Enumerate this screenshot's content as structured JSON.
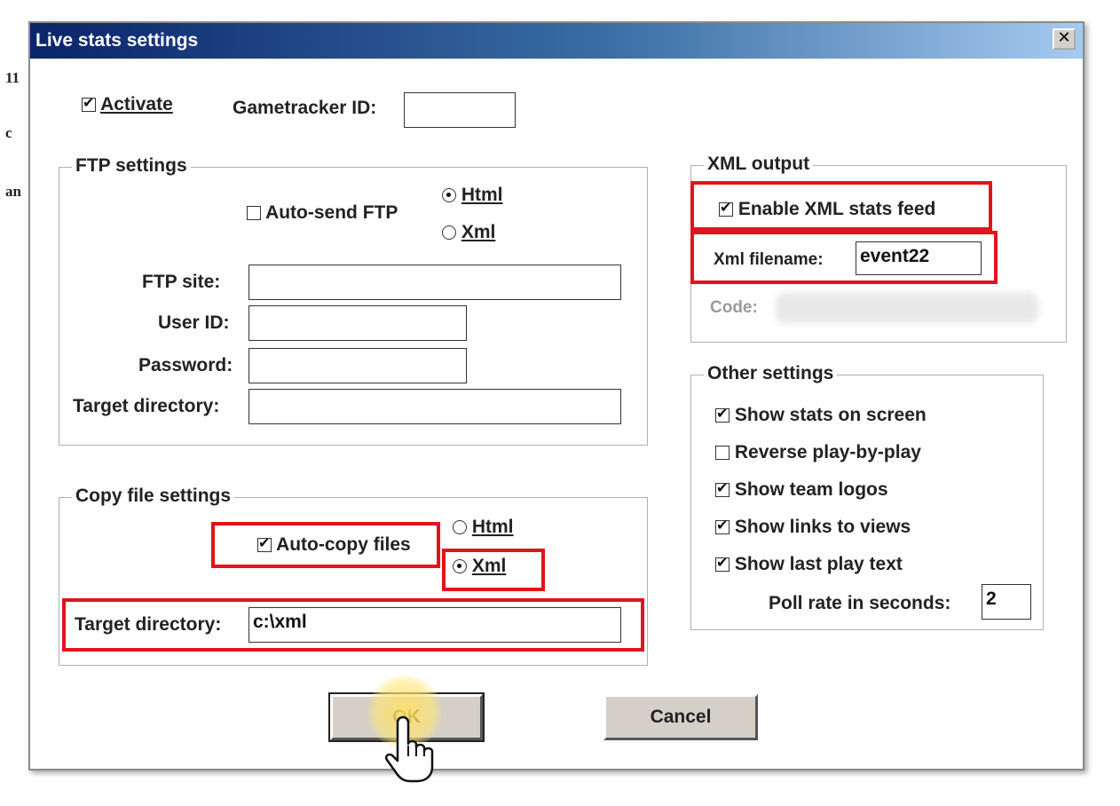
{
  "background": {
    "fragments": [
      "11",
      "c",
      "an"
    ]
  },
  "dialog": {
    "title": "Live stats settings",
    "close_glyph": "✕"
  },
  "activate": {
    "label": "Activate",
    "checked": true
  },
  "gametracker": {
    "label": "Gametracker ID:",
    "value": ""
  },
  "ftp": {
    "group_title": "FTP settings",
    "auto_send_label": "Auto-send FTP",
    "auto_send_checked": false,
    "format_html_label": "Html",
    "format_xml_label": "Xml",
    "format_selected": "Html",
    "site_label": "FTP site:",
    "site_value": "",
    "user_label": "User ID:",
    "user_value": "",
    "password_label": "Password:",
    "password_value": "",
    "target_label": "Target directory:",
    "target_value": ""
  },
  "copy": {
    "group_title": "Copy file settings",
    "auto_copy_label": "Auto-copy files",
    "auto_copy_checked": true,
    "format_html_label": "Html",
    "format_xml_label": "Xml",
    "format_selected": "Xml",
    "target_label": "Target directory:",
    "target_value": "c:\\xml"
  },
  "xml_output": {
    "group_title": "XML output",
    "enable_label": "Enable XML stats feed",
    "enable_checked": true,
    "filename_label": "Xml filename:",
    "filename_value": "event22",
    "code_label": "Code:"
  },
  "other": {
    "group_title": "Other settings",
    "items": [
      {
        "label": "Show stats on screen",
        "checked": true
      },
      {
        "label": "Reverse play-by-play",
        "checked": false
      },
      {
        "label": "Show team logos",
        "checked": true
      },
      {
        "label": "Show links to views",
        "checked": true
      },
      {
        "label": "Show last play text",
        "checked": true
      }
    ],
    "poll_label": "Poll rate in seconds:",
    "poll_value": "2"
  },
  "buttons": {
    "ok": "OK",
    "cancel": "Cancel"
  },
  "colors": {
    "highlight": "#e0141e",
    "titlebar": "#0a246a",
    "button_face": "#d4d0c8"
  },
  "icons": {
    "cursor": "hand-pointer-icon",
    "close": "close-icon"
  }
}
